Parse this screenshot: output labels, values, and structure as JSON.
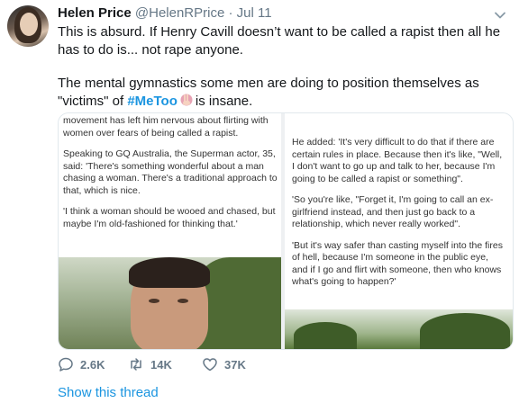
{
  "tweet": {
    "author_name": "Helen Price",
    "handle": "@HelenRPrice",
    "separator": "·",
    "date": "Jul 11",
    "paragraph1": "This is absurd. If Henry Cavill doesn’t want to be called a rapist then all he has to do is... not rape anyone.",
    "paragraph2_prefix": "The mental gymnastics some men are doing to position themselves as \"victims\" of",
    "hashtag": "#MeToo",
    "paragraph2_suffix": "is insane."
  },
  "media": {
    "left_article": [
      "movement has left him nervous about flirting with women over fears of being called a rapist.",
      "Speaking to GQ Australia, the Superman actor, 35, said: 'There's something wonderful about a man chasing a woman. There's a traditional approach to that, which is nice.",
      "'I think a woman should be wooed and chased, but maybe I'm old-fashioned for thinking that.'"
    ],
    "right_article": [
      "He added: 'It's very difficult to do that if there are certain rules in place. Because then it's like, \"Well, I don't want to go up and talk to her, because I'm going to be called a rapist or something\".",
      "'So you're like, \"Forget it, I'm going to call an ex-girlfriend instead, and then just go back to a relationship, which never really worked\".",
      "'But it's way safer than casting myself into the fires of hell, because I'm someone in the public eye, and if I go and flirt with someone, then who knows what's going to happen?'"
    ]
  },
  "actions": {
    "replies": "2.6K",
    "retweets": "14K",
    "likes": "37K"
  },
  "show_thread": "Show this thread",
  "icons": [
    "avatar",
    "chevron-down-icon",
    "reply-icon",
    "retweet-icon",
    "like-icon",
    "metoo-emoji-icon"
  ],
  "colors": {
    "link": "#1b95e0",
    "secondary": "#657786",
    "text": "#14171a"
  }
}
